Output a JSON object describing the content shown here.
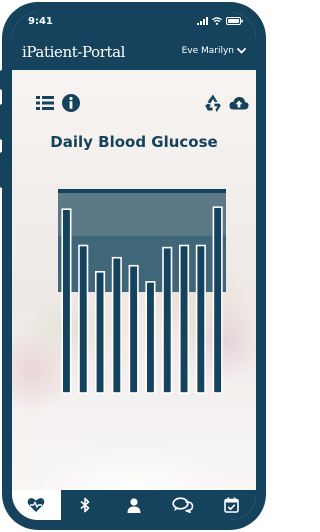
{
  "status_bar": {
    "time": "9:41"
  },
  "header": {
    "app_name": "iPatient-Portal",
    "user_name": "Eve Marilyn"
  },
  "toolbar": {
    "left_icons": [
      "list-icon",
      "info-icon"
    ],
    "right_icons": [
      "recycle-icon",
      "cloud-upload-icon"
    ]
  },
  "page": {
    "title": "Daily Blood Glucose"
  },
  "chart_data": {
    "type": "bar",
    "title": "Daily Blood Glucose",
    "values": [
      0.91,
      0.73,
      0.6,
      0.67,
      0.63,
      0.55,
      0.72,
      0.73,
      0.73,
      0.92
    ],
    "band_low": 0.5,
    "band_high": 1.0,
    "band_split": 0.78
  },
  "tabbar": {
    "tabs": [
      {
        "icon": "heart-icon",
        "active": true
      },
      {
        "icon": "bluetooth-icon",
        "active": false
      },
      {
        "icon": "user-icon",
        "active": false
      },
      {
        "icon": "chat-icon",
        "active": false
      },
      {
        "icon": "calendar-check-icon",
        "active": false
      }
    ]
  },
  "colors": {
    "primary": "#15435e",
    "band_top": "#5b7987",
    "band_bottom": "#3f6679",
    "background": "#ffffff"
  }
}
